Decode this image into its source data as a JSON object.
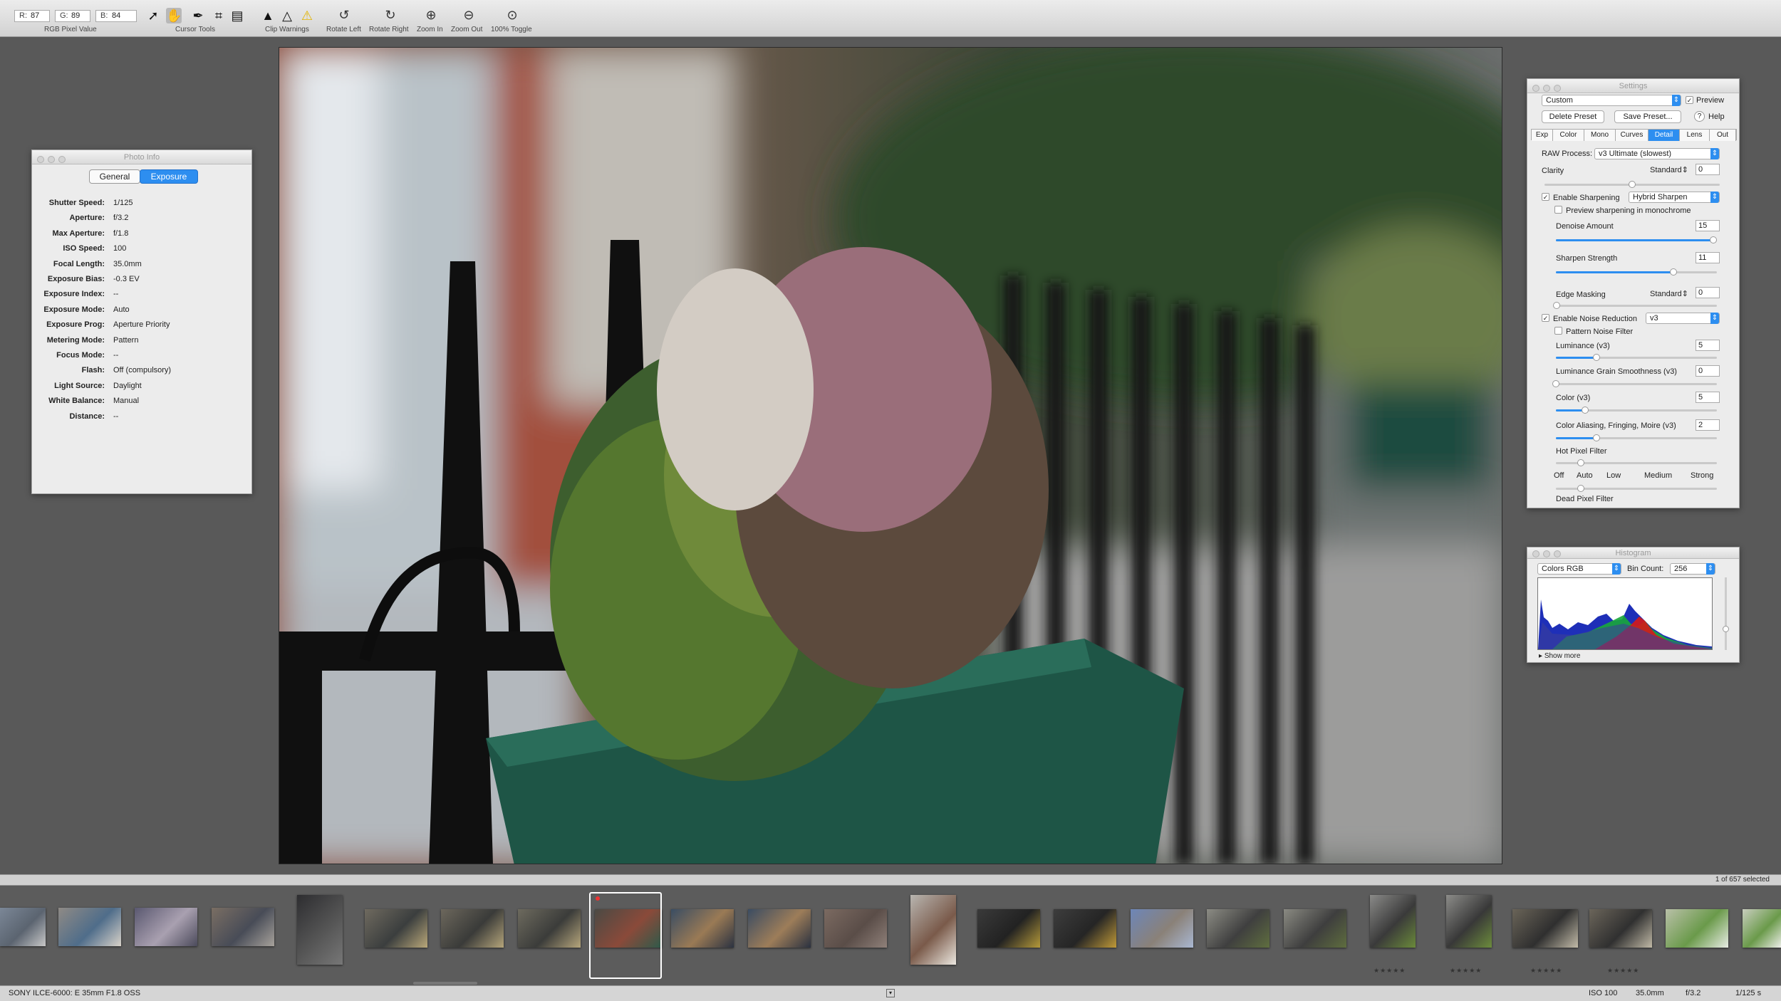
{
  "toolbar": {
    "rgb": {
      "r_label": "R:",
      "r": "87",
      "g_label": "G:",
      "g": "89",
      "b_label": "B:",
      "b": "84",
      "caption": "RGB Pixel Value"
    },
    "cursor_tools_label": "Cursor Tools",
    "clip_warnings_label": "Clip Warnings",
    "rotate_left_label": "Rotate Left",
    "rotate_right_label": "Rotate Right",
    "zoom_in_label": "Zoom In",
    "zoom_out_label": "Zoom Out",
    "toggle_label": "100% Toggle"
  },
  "photo_info": {
    "title": "Photo Info",
    "tabs": [
      "General",
      "Exposure"
    ],
    "active_tab": "Exposure",
    "rows": [
      {
        "k": "Shutter Speed:",
        "v": "1/125"
      },
      {
        "k": "Aperture:",
        "v": "f/3.2"
      },
      {
        "k": "Max Aperture:",
        "v": "f/1.8"
      },
      {
        "k": "ISO Speed:",
        "v": "100"
      },
      {
        "k": "Focal Length:",
        "v": "35.0mm"
      },
      {
        "k": "Exposure Bias:",
        "v": "-0.3 EV"
      },
      {
        "k": "Exposure Index:",
        "v": "--"
      },
      {
        "k": "Exposure Mode:",
        "v": "Auto"
      },
      {
        "k": "Exposure Prog:",
        "v": "Aperture Priority"
      },
      {
        "k": "Metering Mode:",
        "v": "Pattern"
      },
      {
        "k": "Focus Mode:",
        "v": "--"
      },
      {
        "k": "Flash:",
        "v": "Off (compulsory)"
      },
      {
        "k": "Light Source:",
        "v": "Daylight"
      },
      {
        "k": "White Balance:",
        "v": "Manual"
      },
      {
        "k": "Distance:",
        "v": "--"
      }
    ]
  },
  "settings": {
    "title": "Settings",
    "preset": "Custom",
    "preview_label": "Preview",
    "delete_preset": "Delete Preset",
    "save_preset": "Save Preset...",
    "help": "Help",
    "tabs": [
      "Exp",
      "Color",
      "Mono",
      "Curves",
      "Detail",
      "Lens",
      "Out"
    ],
    "active_tab": "Detail",
    "raw_process_label": "RAW Process:",
    "raw_process_value": "v3 Ultimate (slowest)",
    "clarity_label": "Clarity",
    "clarity_mode": "Standard",
    "clarity_value": "0",
    "enable_sharpening": "Enable Sharpening",
    "sharpen_mode": "Hybrid Sharpen",
    "preview_mono": "Preview sharpening in monochrome",
    "denoise_label": "Denoise Amount",
    "denoise_value": "15",
    "denoise_level": 0.98,
    "sharpen_strength_label": "Sharpen Strength",
    "sharpen_strength_value": "11",
    "sharpen_strength_level": 0.73,
    "edge_masking_label": "Edge Masking",
    "edge_masking_mode": "Standard",
    "edge_masking_value": "0",
    "enable_nr": "Enable Noise Reduction",
    "nr_version": "v3",
    "pattern_noise": "Pattern Noise Filter",
    "luminance_label": "Luminance (v3)",
    "luminance_value": "5",
    "luminance_level": 0.25,
    "lgs_label": "Luminance Grain Smoothness (v3)",
    "lgs_value": "0",
    "lgs_level": 0.0,
    "color_label": "Color (v3)",
    "color_value": "5",
    "color_level": 0.18,
    "cafm_label": "Color Aliasing, Fringing, Moire (v3)",
    "cafm_value": "2",
    "cafm_level": 0.25,
    "hot_pixel_label": "Hot Pixel Filter",
    "hot_pixel_levels": [
      "Off",
      "Auto",
      "Low",
      "Medium",
      "Strong"
    ],
    "dead_pixel_label": "Dead Pixel Filter"
  },
  "histogram": {
    "title": "Histogram",
    "channel": "Colors RGB",
    "bin_count_label": "Bin Count:",
    "bin_count": "256",
    "show_more": "Show more"
  },
  "filmstrip": {
    "count_text": "1 of 657 selected",
    "star_text": "★★★★★"
  },
  "status": {
    "camera": "SONY ILCE-6000: E 35mm F1.8 OSS",
    "iso": "ISO 100",
    "focal": "35.0mm",
    "aperture": "f/3.2",
    "shutter": "1/125 s"
  }
}
